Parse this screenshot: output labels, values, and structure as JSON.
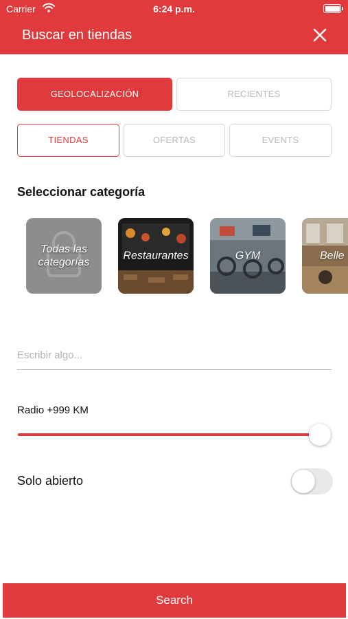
{
  "status_bar": {
    "carrier": "Carrier",
    "time": "6:24 p.m.",
    "icons": [
      "wifi-icon",
      "battery-icon"
    ]
  },
  "header": {
    "title": "Buscar en tiendas",
    "close_icon": "close-icon",
    "color": "#e03a3c"
  },
  "mode_tabs": {
    "geolocation": "GEOLOCALIZACIÓN",
    "recent": "RECIENTES",
    "selected": "GEOLOCALIZACIÓN"
  },
  "type_tabs": {
    "stores": "TIENDAS",
    "offers": "OFERTAS",
    "events": "EVENTS",
    "selected": "TIENDAS"
  },
  "category_section": {
    "title": "Seleccionar categoría",
    "items": [
      {
        "label": "Todas las categorías",
        "id": "all"
      },
      {
        "label": "Restaurantes",
        "id": "restaurants"
      },
      {
        "label": "GYM",
        "id": "gym"
      },
      {
        "label": "Belle",
        "id": "beauty"
      }
    ]
  },
  "search_input": {
    "placeholder": "Escribir algo...",
    "value": ""
  },
  "radius": {
    "label": "Radio +999 KM",
    "level": 1.0
  },
  "open_only": {
    "label": "Solo abierto",
    "enabled": false
  },
  "search_button": {
    "label": "Search"
  }
}
